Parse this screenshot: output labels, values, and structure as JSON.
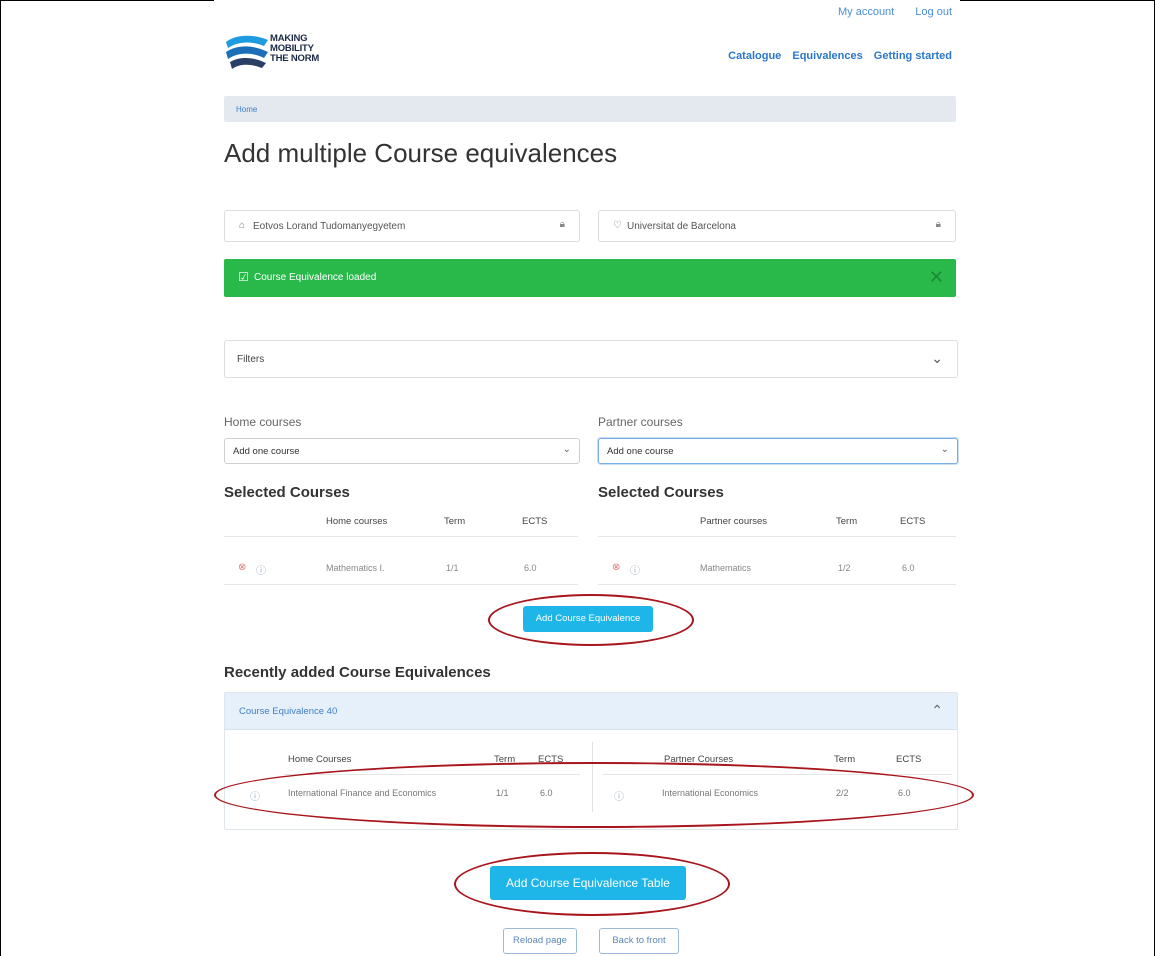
{
  "top_links": [
    "My account",
    "Log out"
  ],
  "logo": {
    "text_line1": "MAKING",
    "text_line2": "MOBILITY",
    "text_line3": "THE NORM"
  },
  "main_nav": [
    "Catalogue",
    "Equivalences",
    "Getting started"
  ],
  "breadcrumb": {
    "home": "Home"
  },
  "page_title": "Add multiple Course equivalences",
  "home_university": "Eotvos Lorand Tudomanyegyetem",
  "partner_university": "Universitat de Barcelona",
  "alert": {
    "message": "Course Equivalence loaded",
    "close": "✕"
  },
  "filters": {
    "label": "Filters"
  },
  "home_courses": {
    "label": "Home courses",
    "select_value": "Add one course",
    "selected_title": "Selected Courses",
    "columns": [
      "Home courses",
      "Term",
      "ECTS"
    ],
    "row": {
      "course": "Mathematics I.",
      "term": "1/1",
      "ects": "6.0"
    }
  },
  "partner_courses": {
    "label": "Partner courses",
    "select_value": "Add one course",
    "selected_title": "Selected Courses",
    "columns": [
      "Partner courses",
      "Term",
      "ECTS"
    ],
    "row": {
      "course": "Mathematics",
      "term": "1/2",
      "ects": "6.0"
    }
  },
  "add_equivalence_button": "Add Course Equivalence",
  "recent": {
    "title": "Recently added Course Equivalences",
    "item_title": "Course Equivalence 40",
    "home_columns": [
      "Home Courses",
      "Term",
      "ECTS"
    ],
    "partner_columns": [
      "Partner Courses",
      "Term",
      "ECTS"
    ],
    "home_row": {
      "course": "International Finance and Economics",
      "term": "1/1",
      "ects": "6.0"
    },
    "partner_row": {
      "course": "International Economics",
      "term": "2/2",
      "ects": "6.0"
    }
  },
  "add_table_button": "Add Course Equivalence Table",
  "reload_button": "Reload page",
  "back_button": "Back to front",
  "colors": {
    "accent": "#1eb6e8",
    "success": "#28b94a",
    "annotation": "#a8151c",
    "link": "#2b78c8"
  },
  "icons": [
    "home-icon",
    "university-icon",
    "lock-icon",
    "check-icon",
    "close-icon",
    "chevron-down-icon",
    "chevron-up-icon",
    "remove-icon",
    "info-icon"
  ]
}
